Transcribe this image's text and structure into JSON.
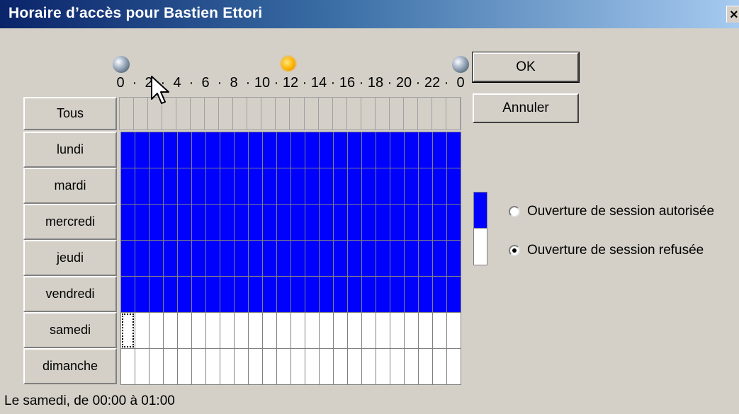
{
  "window": {
    "title": "Horaire d’accès pour Bastien Ettori",
    "close_label": "×"
  },
  "icons": {
    "midnight_start": "moon-icon",
    "noon": "sun-icon",
    "midnight_end": "moon-icon",
    "cursor": "mouse-pointer-icon"
  },
  "hour_axis": [
    "0",
    "·",
    "2",
    "·",
    "4",
    "·",
    "6",
    "·",
    "8",
    "·",
    "10",
    "·",
    "12",
    "·",
    "14",
    "·",
    "16",
    "·",
    "18",
    "·",
    "20",
    "·",
    "22",
    "·",
    "0"
  ],
  "all_button": "Tous",
  "days": [
    "lundi",
    "mardi",
    "mercredi",
    "jeudi",
    "vendredi",
    "samedi",
    "dimanche"
  ],
  "schedule": {
    "hours_per_day": 24,
    "allowed": [
      [
        true,
        true,
        true,
        true,
        true,
        true,
        true,
        true,
        true,
        true,
        true,
        true,
        true,
        true,
        true,
        true,
        true,
        true,
        true,
        true,
        true,
        true,
        true,
        true
      ],
      [
        true,
        true,
        true,
        true,
        true,
        true,
        true,
        true,
        true,
        true,
        true,
        true,
        true,
        true,
        true,
        true,
        true,
        true,
        true,
        true,
        true,
        true,
        true,
        true
      ],
      [
        true,
        true,
        true,
        true,
        true,
        true,
        true,
        true,
        true,
        true,
        true,
        true,
        true,
        true,
        true,
        true,
        true,
        true,
        true,
        true,
        true,
        true,
        true,
        true
      ],
      [
        true,
        true,
        true,
        true,
        true,
        true,
        true,
        true,
        true,
        true,
        true,
        true,
        true,
        true,
        true,
        true,
        true,
        true,
        true,
        true,
        true,
        true,
        true,
        true
      ],
      [
        true,
        true,
        true,
        true,
        true,
        true,
        true,
        true,
        true,
        true,
        true,
        true,
        true,
        true,
        true,
        true,
        true,
        true,
        true,
        true,
        true,
        true,
        true,
        true
      ],
      [
        false,
        false,
        false,
        false,
        false,
        false,
        false,
        false,
        false,
        false,
        false,
        false,
        false,
        false,
        false,
        false,
        false,
        false,
        false,
        false,
        false,
        false,
        false,
        false
      ],
      [
        false,
        false,
        false,
        false,
        false,
        false,
        false,
        false,
        false,
        false,
        false,
        false,
        false,
        false,
        false,
        false,
        false,
        false,
        false,
        false,
        false,
        false,
        false,
        false
      ]
    ],
    "focused_day": 5,
    "focused_hour": 0,
    "allowed_color": "#0000ff",
    "denied_color": "#ffffff"
  },
  "buttons": {
    "ok": "OK",
    "cancel": "Annuler"
  },
  "legend": {
    "allowed_label": "Ouverture de session autorisée",
    "denied_label": "Ouverture de session refusée",
    "selected": "denied"
  },
  "status_text": "Le samedi, de 00:00 à 01:00"
}
